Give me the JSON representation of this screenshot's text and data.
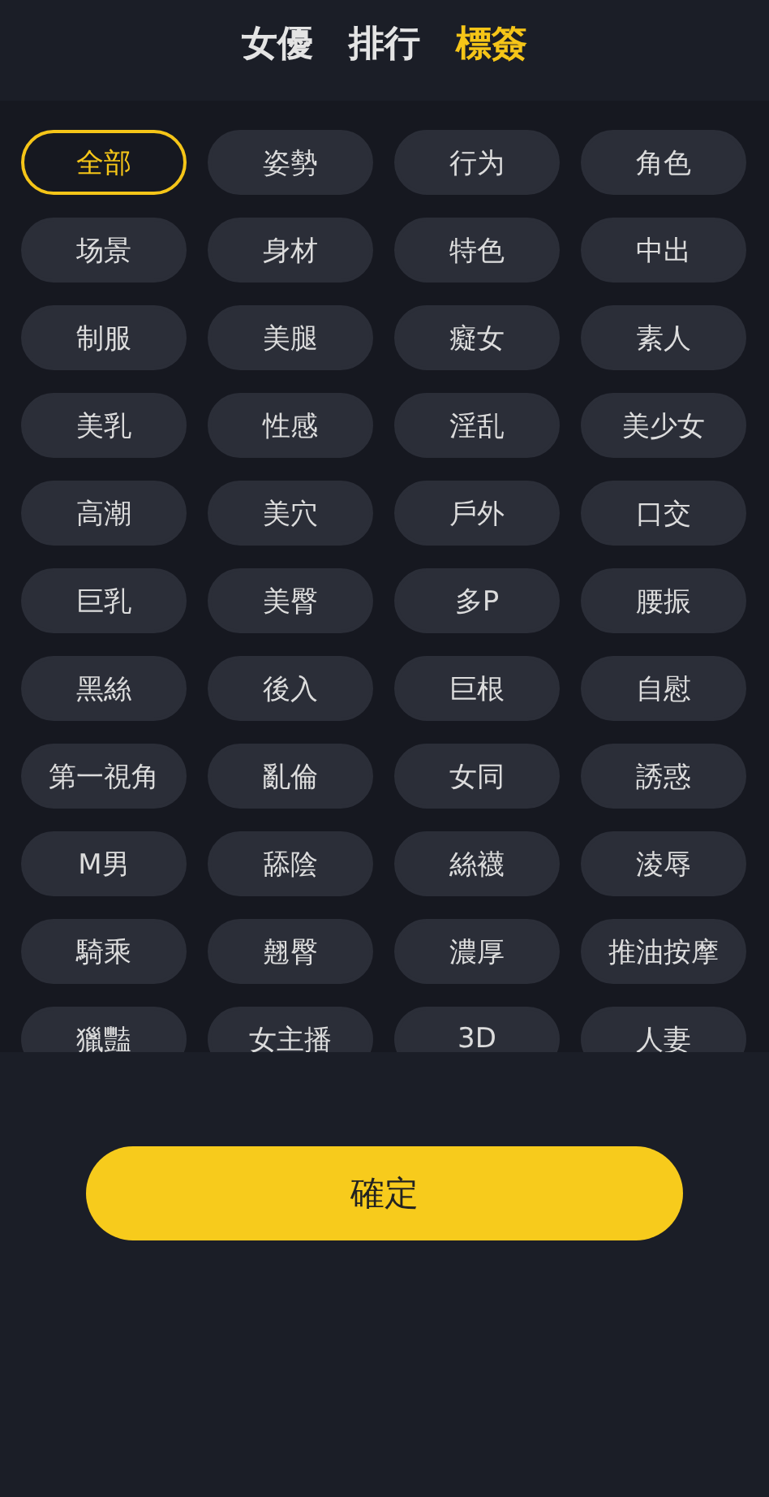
{
  "tabs": [
    {
      "label": "女優",
      "selected": false
    },
    {
      "label": "排行",
      "selected": false
    },
    {
      "label": "標簽",
      "selected": true
    }
  ],
  "tags": [
    {
      "label": "全部",
      "selected": true
    },
    {
      "label": "姿勢",
      "selected": false
    },
    {
      "label": "行为",
      "selected": false
    },
    {
      "label": "角色",
      "selected": false
    },
    {
      "label": "场景",
      "selected": false
    },
    {
      "label": "身材",
      "selected": false
    },
    {
      "label": "特色",
      "selected": false
    },
    {
      "label": "中出",
      "selected": false
    },
    {
      "label": "制服",
      "selected": false
    },
    {
      "label": "美腿",
      "selected": false
    },
    {
      "label": "癡女",
      "selected": false
    },
    {
      "label": "素人",
      "selected": false
    },
    {
      "label": "美乳",
      "selected": false
    },
    {
      "label": "性感",
      "selected": false
    },
    {
      "label": "淫乱",
      "selected": false
    },
    {
      "label": "美少女",
      "selected": false
    },
    {
      "label": "高潮",
      "selected": false
    },
    {
      "label": "美穴",
      "selected": false
    },
    {
      "label": "戶外",
      "selected": false
    },
    {
      "label": "口交",
      "selected": false
    },
    {
      "label": "巨乳",
      "selected": false
    },
    {
      "label": "美臀",
      "selected": false
    },
    {
      "label": "多P",
      "selected": false
    },
    {
      "label": "腰振",
      "selected": false
    },
    {
      "label": "黑絲",
      "selected": false
    },
    {
      "label": "後入",
      "selected": false
    },
    {
      "label": "巨根",
      "selected": false
    },
    {
      "label": "自慰",
      "selected": false
    },
    {
      "label": "第一視角",
      "selected": false
    },
    {
      "label": "亂倫",
      "selected": false
    },
    {
      "label": "女同",
      "selected": false
    },
    {
      "label": "誘惑",
      "selected": false
    },
    {
      "label": "M男",
      "selected": false
    },
    {
      "label": "舔陰",
      "selected": false
    },
    {
      "label": "絲襪",
      "selected": false
    },
    {
      "label": "淩辱",
      "selected": false
    },
    {
      "label": "騎乘",
      "selected": false
    },
    {
      "label": "翹臀",
      "selected": false
    },
    {
      "label": "濃厚",
      "selected": false
    },
    {
      "label": "推油按摩",
      "selected": false
    },
    {
      "label": "獵豔",
      "selected": false
    },
    {
      "label": "女主播",
      "selected": false
    },
    {
      "label": "3D",
      "selected": false
    },
    {
      "label": "人妻",
      "selected": false
    }
  ],
  "confirm_button": "確定"
}
